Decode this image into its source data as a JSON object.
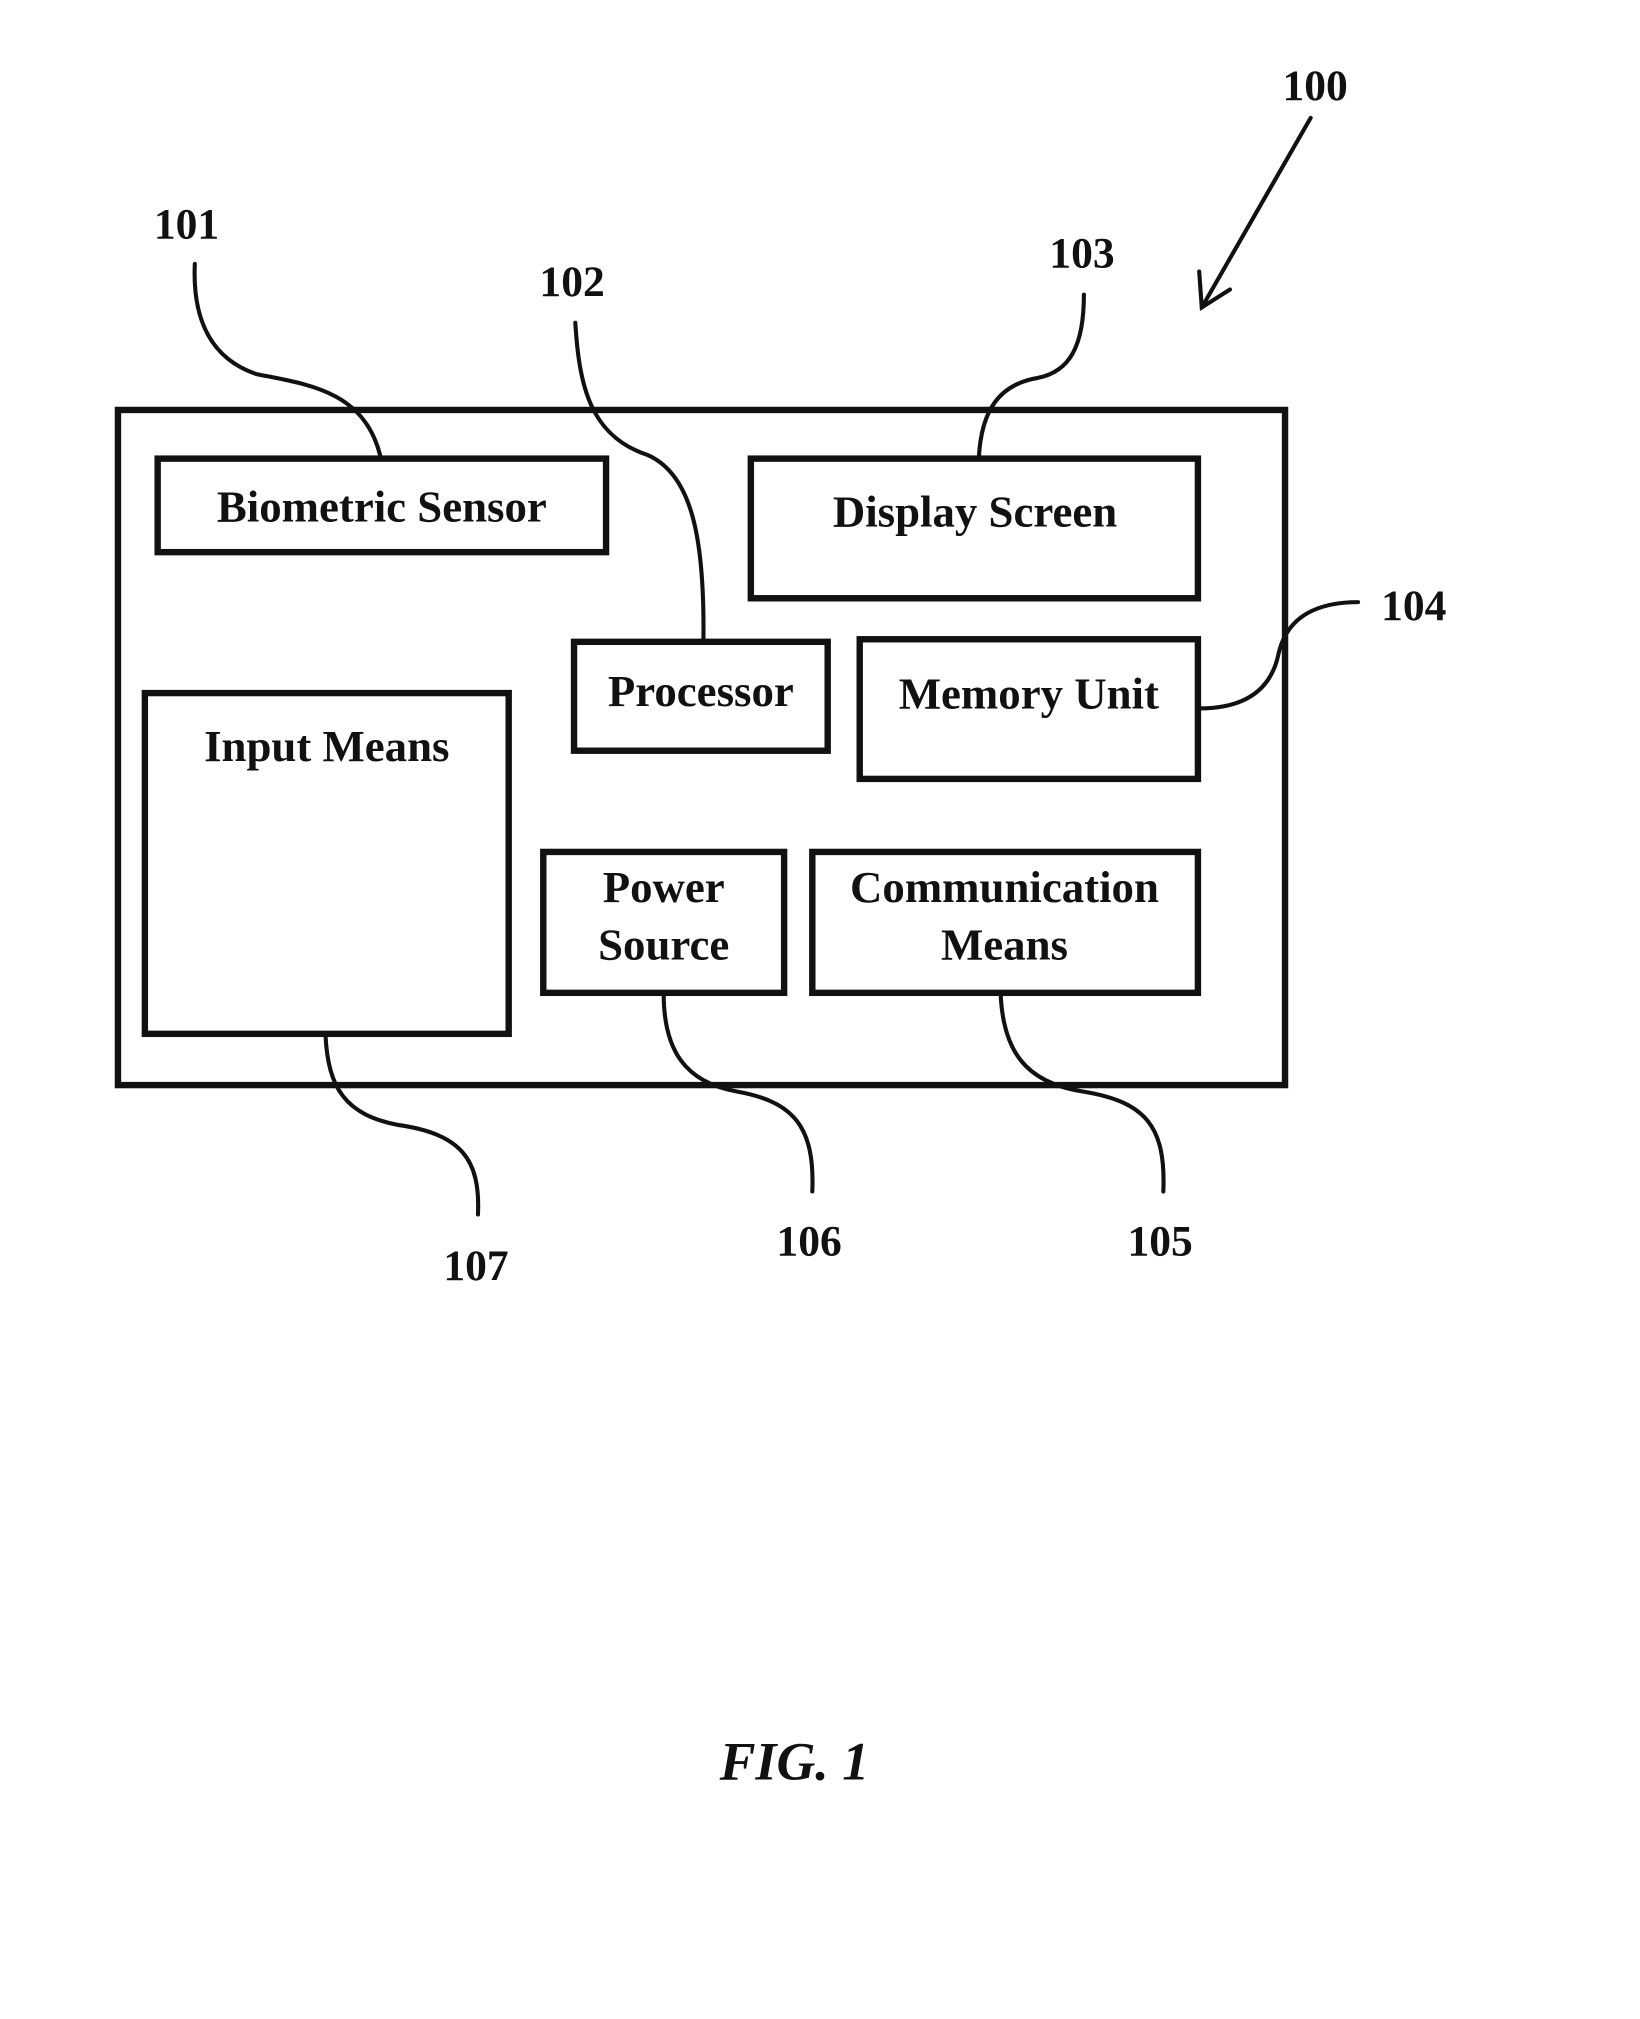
{
  "figure": {
    "caption": "FIG. 1",
    "device_ref": "100"
  },
  "components": {
    "biometric_sensor": {
      "label": "Biometric Sensor",
      "ref": "101"
    },
    "processor": {
      "label": "Processor",
      "ref": "102"
    },
    "display_screen": {
      "label": "Display Screen",
      "ref": "103"
    },
    "memory_unit": {
      "label": "Memory Unit",
      "ref": "104"
    },
    "communication_means": {
      "label_line1": "Communication",
      "label_line2": "Means",
      "ref": "105"
    },
    "power_source": {
      "label_line1": "Power",
      "label_line2": "Source",
      "ref": "106"
    },
    "input_means": {
      "label": "Input Means",
      "ref": "107"
    }
  }
}
